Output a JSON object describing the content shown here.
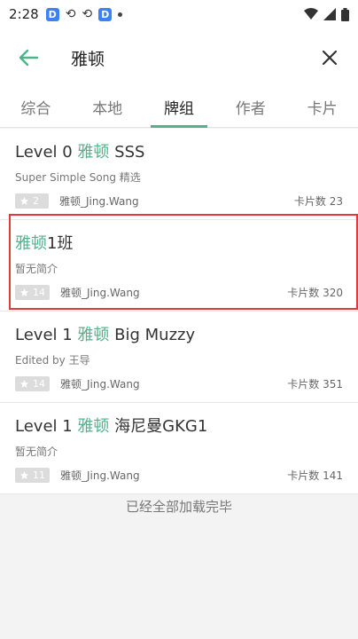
{
  "status_bar": {
    "time": "2:28",
    "notif_d_label": "D"
  },
  "app_bar": {
    "title": "雅顿"
  },
  "tabs": [
    "综合",
    "本地",
    "牌组",
    "作者",
    "卡片"
  ],
  "active_tab_index": 2,
  "accent_color": "#4fb38b",
  "items": [
    {
      "title_prefix": "Level 0 ",
      "title_hl": "雅顿",
      "title_suffix": " SSS",
      "desc": "Super Simple Song 精选",
      "stars": "2",
      "author": "雅顿_Jing.Wang",
      "count": "卡片数 23"
    },
    {
      "title_prefix": "",
      "title_hl": "雅顿",
      "title_suffix": "1班",
      "desc": "暂无简介",
      "stars": "14",
      "author": "雅顿_Jing.Wang",
      "count": "卡片数 320"
    },
    {
      "title_prefix": "Level 1 ",
      "title_hl": "雅顿",
      "title_suffix": " Big Muzzy",
      "desc": "Edited by 王导",
      "stars": "14",
      "author": "雅顿_Jing.Wang",
      "count": "卡片数 351"
    },
    {
      "title_prefix": "Level 1 ",
      "title_hl": "雅顿",
      "title_suffix": " 海尼曼GKG1",
      "desc": "暂无简介",
      "stars": "11",
      "author": "雅顿_Jing.Wang",
      "count": "卡片数 141"
    }
  ],
  "footer": "已经全部加载完毕"
}
